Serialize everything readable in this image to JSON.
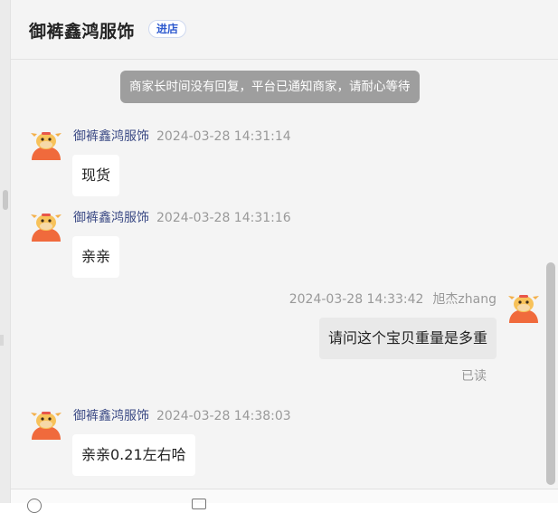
{
  "header": {
    "shop_name": "御裤鑫鸿服饰",
    "enter_shop_label": "进店"
  },
  "notice": "商家长时间没有回复，平台已通知商家，请耐心等待",
  "messages": [
    {
      "sender": "御裤鑫鸿服饰",
      "time": "2024-03-28 14:31:14",
      "text": "现货"
    },
    {
      "sender": "御裤鑫鸿服饰",
      "time": "2024-03-28 14:31:16",
      "text": "亲亲"
    },
    {
      "sender": "旭杰zhang",
      "time": "2024-03-28 14:33:42",
      "text": "请问这个宝贝重量是多重",
      "status": "已读"
    },
    {
      "sender": "御裤鑫鸿服饰",
      "time": "2024-03-28 14:38:03",
      "text": "亲亲0.21左右哈"
    }
  ],
  "icons": {
    "shop_avatar": "cow-mascot-icon",
    "user_avatar": "cow-mascot-icon"
  },
  "colors": {
    "accent_blue": "#2f5bcf",
    "sender_name": "#3b4a85",
    "notice_bg": "#9e9e9e",
    "avatar_orange": "#f06a3c"
  }
}
